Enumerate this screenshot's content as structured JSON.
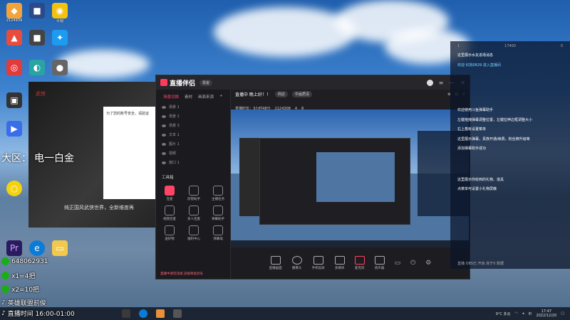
{
  "desktop": {
    "icons": [
      {
        "label": "2124939",
        "color": "#f3a33a"
      },
      {
        "label": "",
        "color": "#2b4a8a"
      },
      {
        "label": "计划",
        "color": "#f4c20d"
      },
      {
        "label": "",
        "color": "#e84c3d"
      },
      {
        "label": "",
        "color": "#444"
      },
      {
        "label": "",
        "color": "#1d9bf0"
      },
      {
        "label": "",
        "color": "#e23b3b"
      },
      {
        "label": "",
        "color": "#29a3a3"
      },
      {
        "label": "",
        "color": "#666"
      }
    ]
  },
  "banner": {
    "region": "大区：",
    "server": "电一白金",
    "tagline": "纯正国风武侠世界，全新维度再",
    "dialog_text": "为了您的账号安全，请验证"
  },
  "app": {
    "title": "直播伴侣",
    "badge": "极客",
    "tabs": [
      "场景切换",
      "素材",
      "画面来源"
    ],
    "status_text": "直播中 晚上好！！",
    "status_tag": "商店",
    "preset": "中画质清",
    "stream_info": "直播时长：3小时48分",
    "follower": "2124308",
    "viewers": "4",
    "likes": "8",
    "scenes": [
      "场景 1",
      "场景 2",
      "场景 3",
      "文本 1",
      "图片 1",
      "视频",
      "窗口 1"
    ],
    "tools_title": "工具箱",
    "tools": [
      {
        "label": "连麦",
        "accent": true
      },
      {
        "label": "房管助手",
        "accent": false
      },
      {
        "label": "主播任务",
        "accent": false
      },
      {
        "label": "视频连麦",
        "accent": false
      },
      {
        "label": "多人连麦",
        "accent": false
      },
      {
        "label": "弹幕助手",
        "accent": false
      },
      {
        "label": "送好物",
        "accent": false
      },
      {
        "label": "福利中心",
        "accent": false
      },
      {
        "label": "弹幕墙",
        "accent": false
      }
    ],
    "warning": "直播中请勿违规 违规将会封号"
  },
  "bottom_controls": [
    "直播画面",
    "摄像头",
    "手机投屏",
    "多媒体",
    "麦克风",
    "扬声器"
  ],
  "chat": {
    "header_left": "1",
    "header_mid": "17400",
    "header_right": "0",
    "messages": [
      {
        "text": "这里展示水友进场消息",
        "sys": false
      },
      {
        "text": "欢迎 红狗0829 进入直播间",
        "sys": true
      },
      {
        "text": "欢迎使用斗鱼弹幕助手",
        "sys": false
      },
      {
        "text": "左键拖拽弹幕调整位置，左键拉伸边框调整大小",
        "sys": false
      },
      {
        "text": "右上角有设置菜单",
        "sys": false
      },
      {
        "text": "这里展示弹幕，贵族开通/续费，粉丝牌升级等",
        "sys": false
      },
      {
        "text": "添加弹幕助手成功",
        "sys": false
      },
      {
        "text": "这里展示你收到的礼物、道具",
        "sys": false
      },
      {
        "text": "点菜单可设置小礼物屏蔽",
        "sys": false
      }
    ],
    "footer": "直播 OBS已 开启 高于0 数据"
  },
  "overlay": {
    "qq": "648062931",
    "line1": "x1=4把",
    "line2": "x2=10把",
    "name": "英雄联盟前俊",
    "schedule": "直播时间 16:00-01:00"
  },
  "taskbar": {
    "weather": "9°C 多云",
    "ime": "中",
    "time": "17:47",
    "date": "2022/12/20"
  }
}
